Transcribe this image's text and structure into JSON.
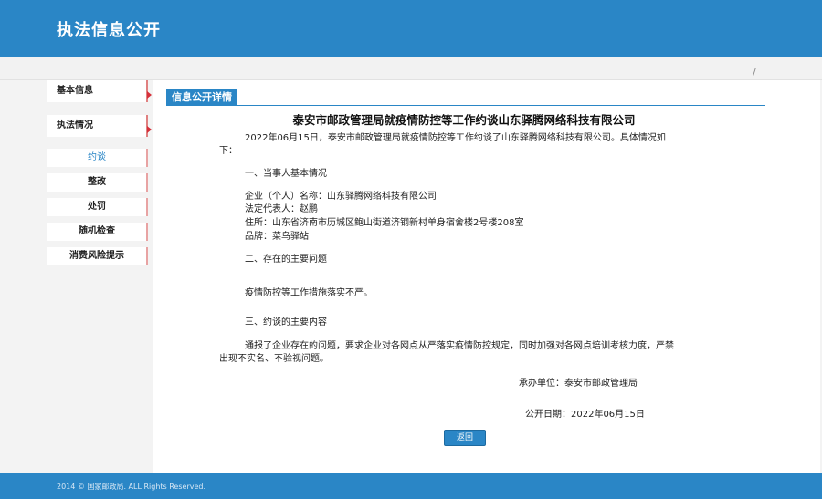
{
  "header": {
    "title": "执法信息公开"
  },
  "subbar": {
    "slash": "/"
  },
  "sidebar": {
    "items": [
      {
        "label": "基本信息"
      },
      {
        "label": "执法情况"
      }
    ],
    "subitems": [
      {
        "label": "约谈",
        "active": true
      },
      {
        "label": "整改"
      },
      {
        "label": "处罚"
      },
      {
        "label": "随机检查"
      },
      {
        "label": "消费风险提示"
      }
    ]
  },
  "content": {
    "tab_label": "信息公开详情",
    "title": "泰安市邮政管理局就疫情防控等工作约谈山东驿腾网络科技有限公司",
    "intro_line1": "2022年06月15日，泰安市邮政管理局就疫情防控等工作约谈了山东驿腾网络科技有限公司。具体情况如",
    "intro_line2": "下：",
    "section1": "一、当事人基本情况",
    "company": "企业（个人）名称：山东驿腾网络科技有限公司",
    "legal_rep": "法定代表人：赵鹏",
    "address": "住所：山东省济南市历城区鲍山街道济钢新村单身宿舍楼2号楼208室",
    "brand": "品牌：菜鸟驿站",
    "section2": "二、存在的主要问题",
    "problem": "疫情防控等工作措施落实不严。",
    "section3": "三、约谈的主要内容",
    "content_line1": "通报了企业存在的问题，要求企业对各网点从严落实疫情防控规定，同时加强对各网点培训考核力度，严禁",
    "content_line2": "出现不实名、不验视问题。",
    "organizer": "承办单位：泰安市邮政管理局",
    "publish_date": "公开日期：2022年06月15日",
    "back_label": "返回"
  },
  "footer": {
    "copyright": "2014 © 国家邮政局. ALL Rights Reserved."
  },
  "colors": {
    "brand": "#2a86c6",
    "accent_red": "#d6303a"
  }
}
